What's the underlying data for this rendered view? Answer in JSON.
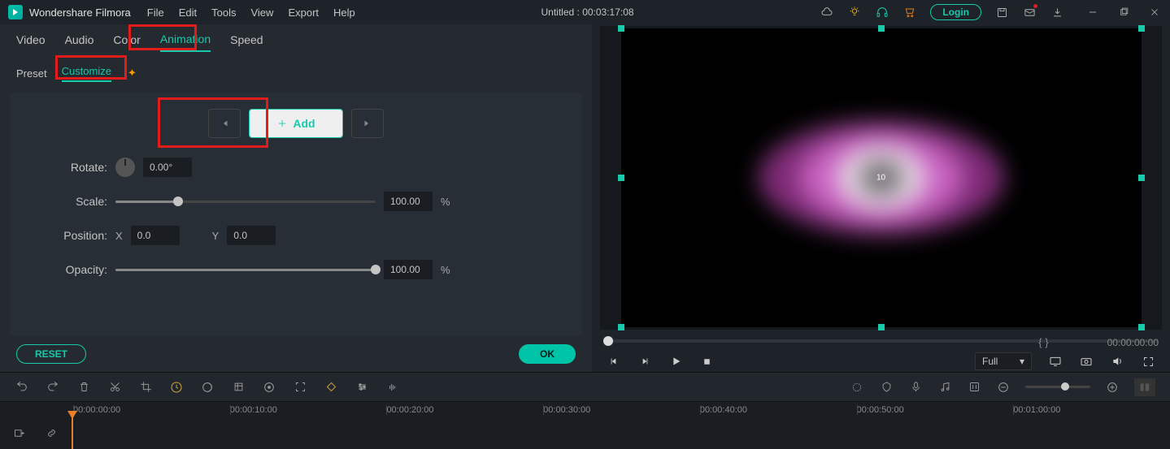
{
  "app": {
    "title": "Wondershare Filmora"
  },
  "menu": {
    "file": "File",
    "edit": "Edit",
    "tools": "Tools",
    "view": "View",
    "export": "Export",
    "help": "Help"
  },
  "titlebar": {
    "doc": "Untitled : 00:03:17:08",
    "login": "Login"
  },
  "tabs": {
    "video": "Video",
    "audio": "Audio",
    "color": "Color",
    "animation": "Animation",
    "speed": "Speed"
  },
  "subtabs": {
    "preset": "Preset",
    "customize": "Customize"
  },
  "keyframe": {
    "add": "Add"
  },
  "props": {
    "rotate_label": "Rotate:",
    "rotate_value": "0.00°",
    "scale_label": "Scale:",
    "scale_value": "100.00",
    "scale_pct": "%",
    "position_label": "Position:",
    "x_label": "X",
    "x_value": "0.0",
    "y_label": "Y",
    "y_value": "0.0",
    "opacity_label": "Opacity:",
    "opacity_value": "100.00",
    "opacity_pct": "%"
  },
  "actions": {
    "reset": "RESET",
    "ok": "OK"
  },
  "preview": {
    "brackets": "{           }",
    "time": "00:00:00:00",
    "resolution": "Full",
    "center_text": "10"
  },
  "timeline": {
    "ticks": [
      "00:00:00:00",
      "00:00:10:00",
      "00:00:20:00",
      "00:00:30:00",
      "00:00:40:00",
      "00:00:50:00",
      "00:01:00:00"
    ]
  }
}
